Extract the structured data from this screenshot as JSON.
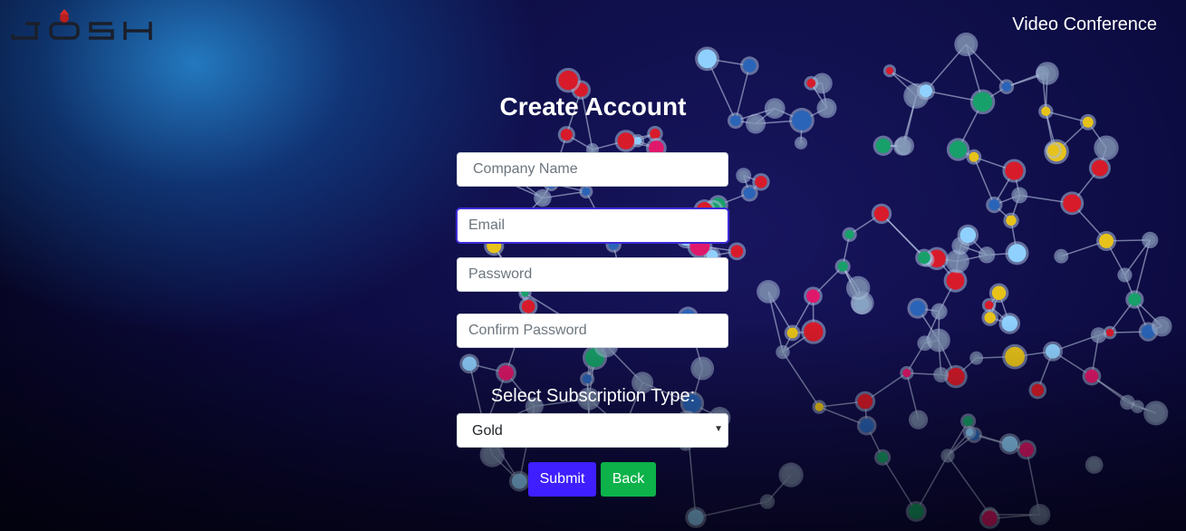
{
  "header": {
    "logo_text": "JOSH",
    "nav_link": "Video Conference"
  },
  "form": {
    "title": "Create Account",
    "company_placeholder": "Company Name",
    "email_placeholder": "Email",
    "password_placeholder": "Password",
    "confirm_placeholder": "Confirm Password",
    "subscription_label": "Select Subscription Type:",
    "subscription_selected": "Gold",
    "submit_label": "Submit",
    "back_label": "Back"
  },
  "colors": {
    "submit_button": "#3f1fff",
    "back_button": "#0db24a",
    "logo_dark": "#1a1f2b",
    "logo_accent": "#d62a2a"
  },
  "icons": {
    "select_caret": "caret-down-icon",
    "logo_mark": "josh-logo"
  }
}
